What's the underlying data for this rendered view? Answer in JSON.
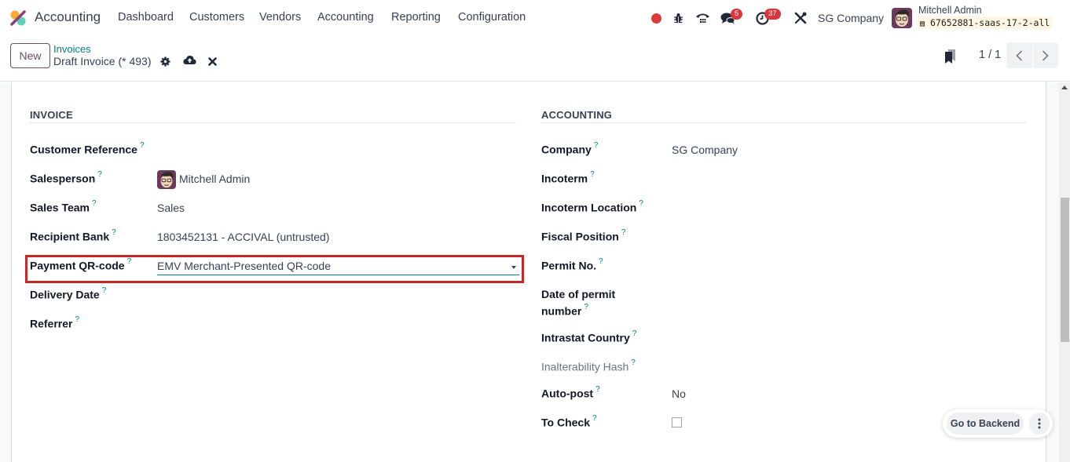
{
  "navbar": {
    "app_name": "Accounting",
    "menu": [
      "Dashboard",
      "Customers",
      "Vendors",
      "Accounting",
      "Reporting",
      "Configuration"
    ],
    "icons": [
      "record-dot-icon",
      "bug-icon",
      "phone-icon",
      "chat-icon",
      "activity-clock-icon",
      "tools-icon"
    ],
    "chat_badge": "5",
    "activity_badge": "37",
    "company": "SG Company",
    "user_name": "Mitchell Admin",
    "db_name": "67652881-saas-17-2-all",
    "colors": {
      "badge": "#d9363e",
      "record": "#dc3c3c"
    }
  },
  "control_panel": {
    "new_label": "New",
    "breadcrumb": "Invoices",
    "record_title": "Draft Invoice (* 493)",
    "icons": [
      "gear-icon",
      "cloud-upload-icon",
      "discard-icon"
    ],
    "pager_value": "1 / 1",
    "pager_prev": "‹",
    "pager_next": "›",
    "colors": {
      "brand": "#714b67",
      "link": "#017e84"
    }
  },
  "invoice_section": {
    "title": "INVOICE",
    "fields": [
      {
        "label": "Customer Reference",
        "value": ""
      },
      {
        "label": "Salesperson",
        "value": "Mitchell Admin"
      },
      {
        "label": "Sales Team",
        "value": "Sales"
      },
      {
        "label": "Recipient Bank",
        "value": "1803452131 - ACCIVAL (untrusted)"
      },
      {
        "label": "Payment QR-code",
        "value": "EMV Merchant-Presented QR-code"
      },
      {
        "label": "Delivery Date",
        "value": ""
      },
      {
        "label": "Referrer",
        "value": ""
      }
    ]
  },
  "accounting_section": {
    "title": "ACCOUNTING",
    "fields": [
      {
        "label": "Company",
        "value": "SG Company"
      },
      {
        "label": "Incoterm",
        "value": ""
      },
      {
        "label": "Incoterm Location",
        "value": ""
      },
      {
        "label": "Fiscal Position",
        "value": ""
      },
      {
        "label": "Permit No.",
        "value": ""
      },
      {
        "label": "Date of permit",
        "label2": "number",
        "value": ""
      },
      {
        "label": "Intrastat Country",
        "value": ""
      },
      {
        "label": "Inalterability Hash",
        "value": ""
      },
      {
        "label": "Auto-post",
        "value": "No"
      },
      {
        "label": "To Check",
        "value": false
      }
    ]
  },
  "help_mark": "?",
  "floating": {
    "backend_label": "Go to Backend",
    "more_label": "⋮"
  },
  "highlight_color": "#c62828"
}
